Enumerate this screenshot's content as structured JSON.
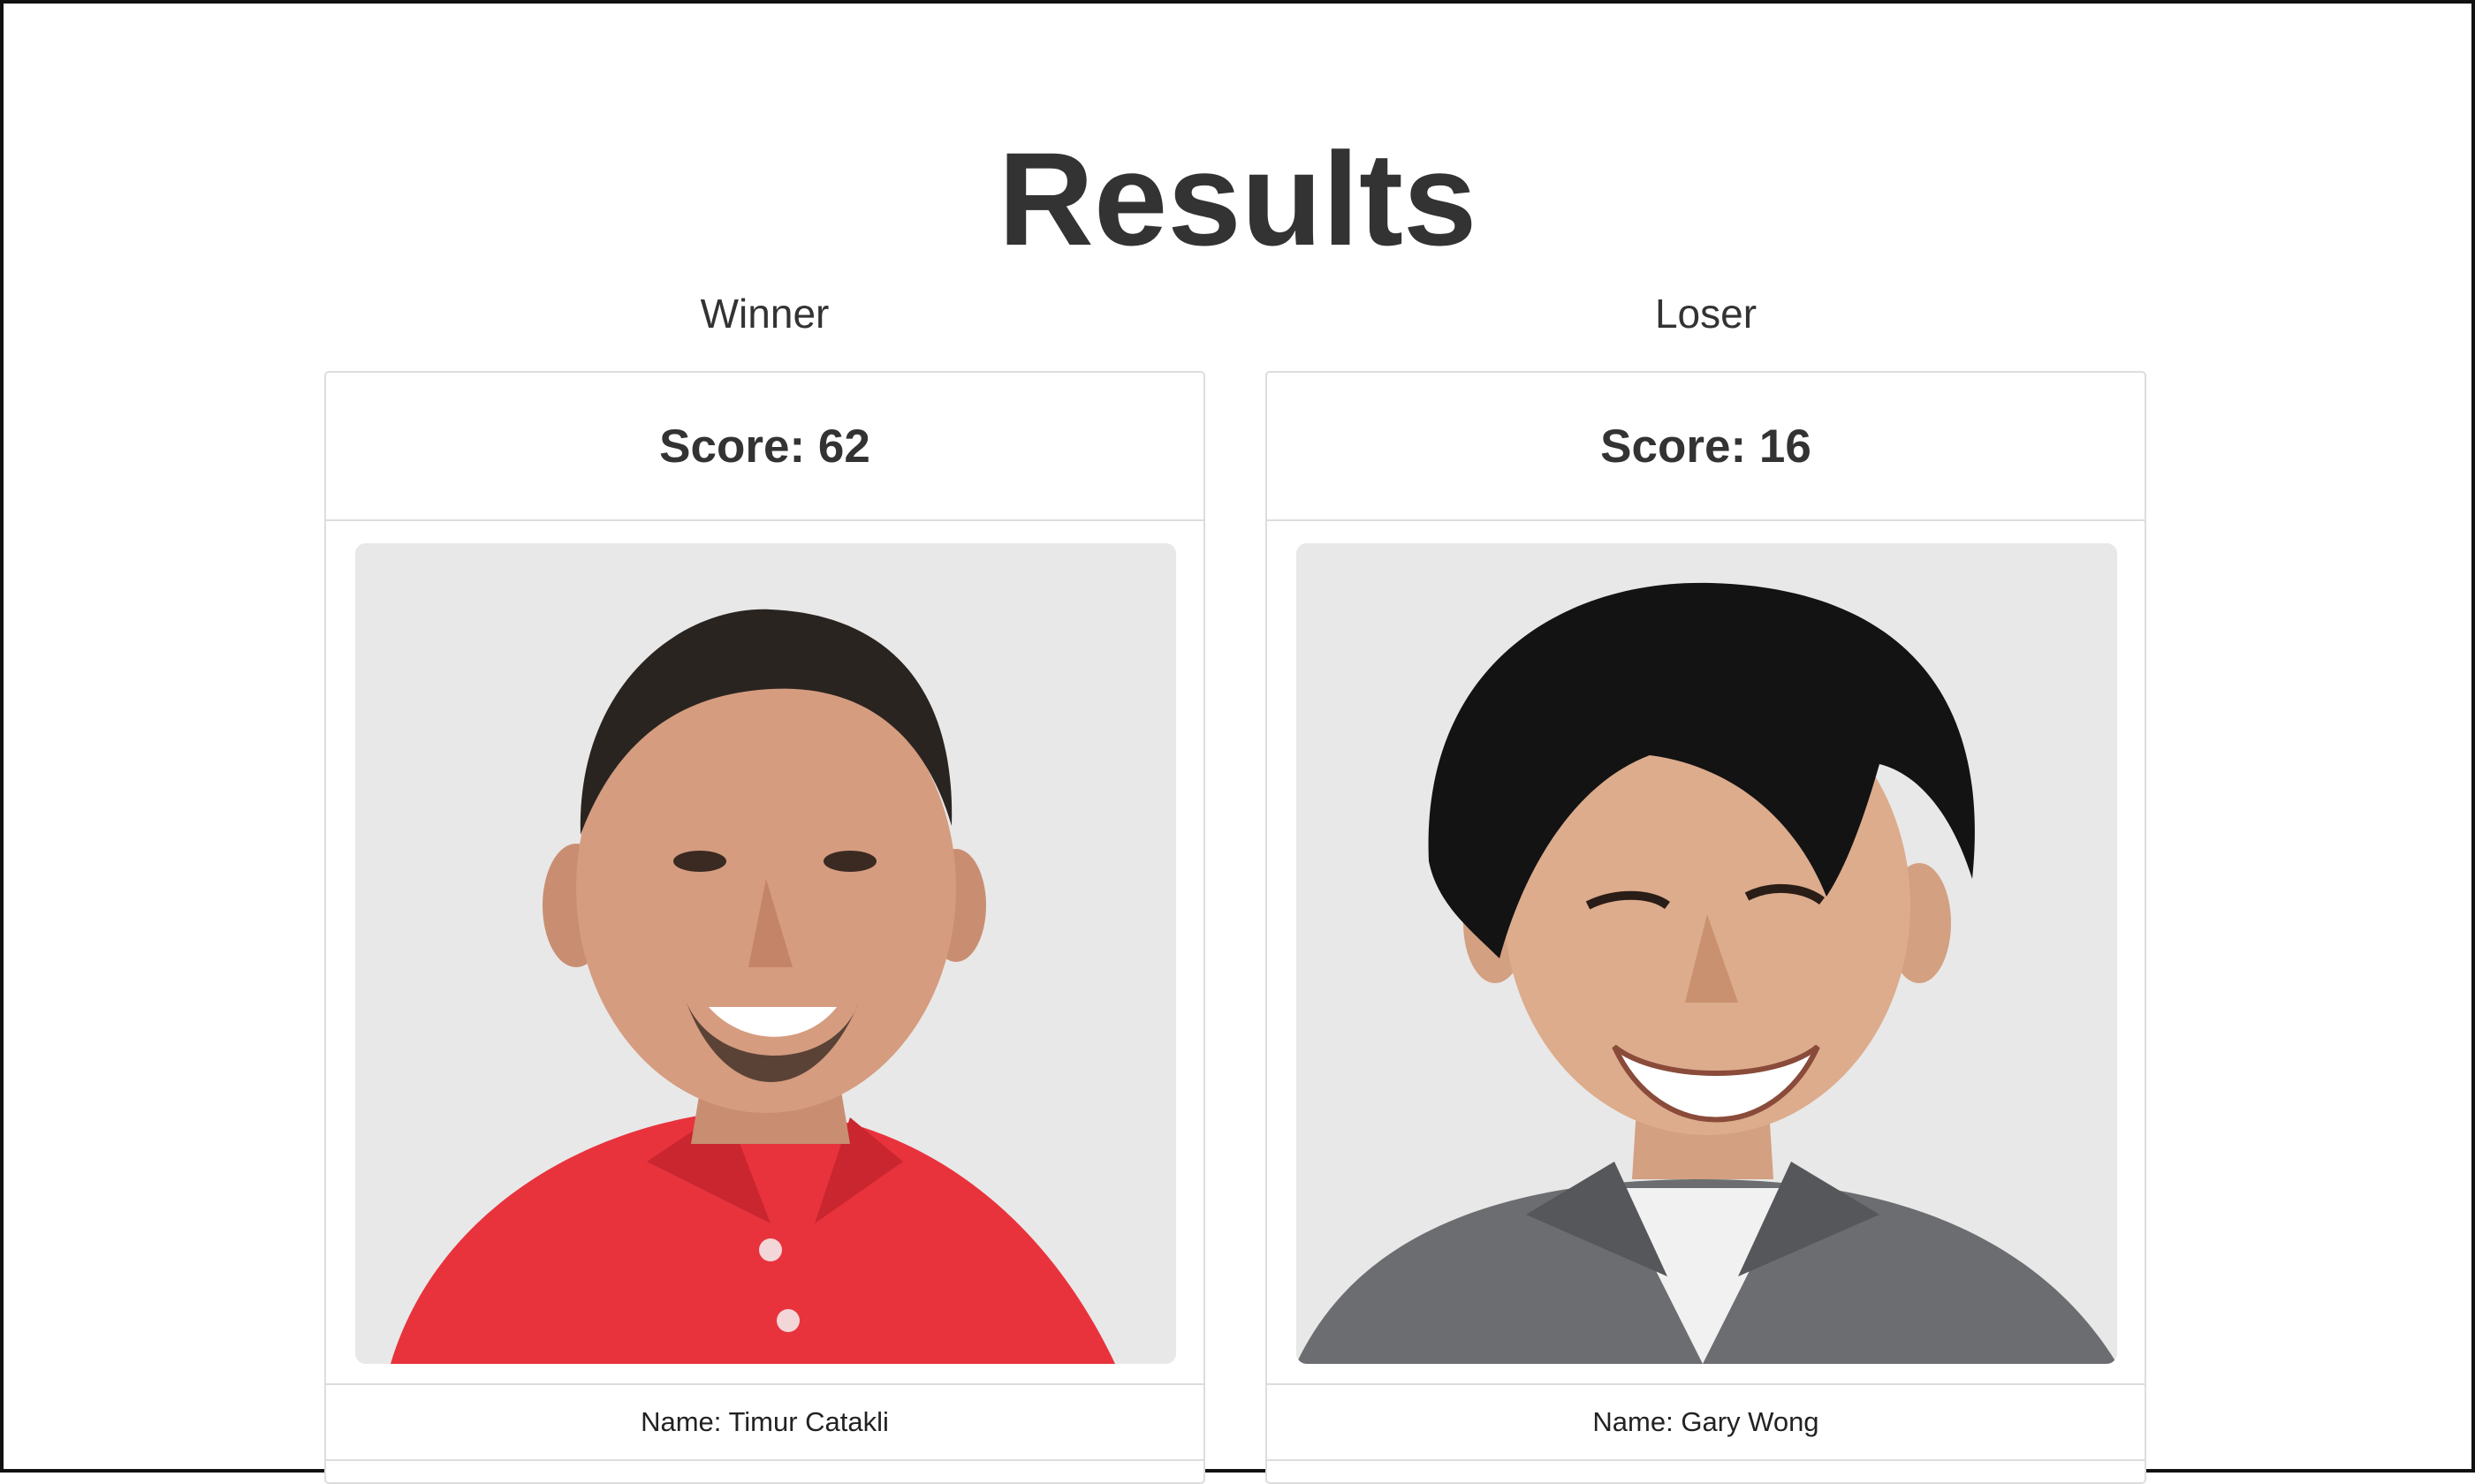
{
  "page": {
    "title": "Results"
  },
  "columns": [
    {
      "label": "Winner",
      "score_label": "Score: 62",
      "name_label": "Name: Timur Catakli",
      "photo_icon": "person-portrait-red-shirt"
    },
    {
      "label": "Loser",
      "score_label": "Score: 16",
      "name_label": "Name: Gary Wong",
      "photo_icon": "person-portrait-gray-jacket"
    }
  ],
  "colors": {
    "text": "#333333",
    "border": "#dddddd",
    "shirt_red": "#e8333d",
    "jacket_gray": "#6b6d70"
  }
}
